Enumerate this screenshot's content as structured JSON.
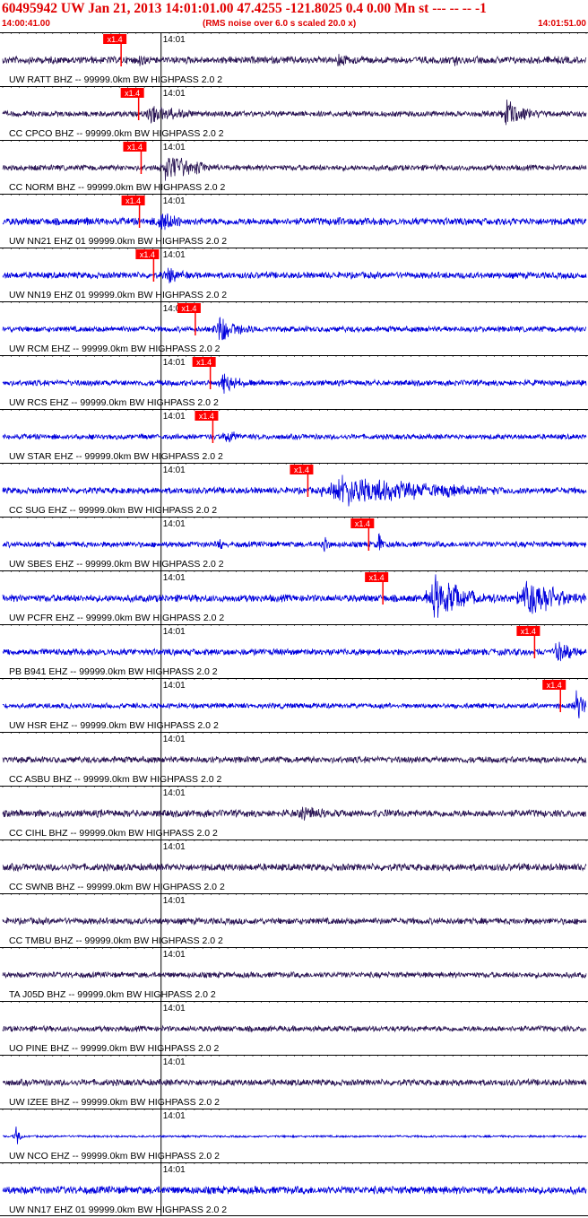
{
  "header": {
    "title": "60495942 UW Jan 21, 2013 14:01:01.00   47.4255 -121.8025  0.4 0.00 Mn st --- -- --   -1",
    "start_time": "14:00:41.00",
    "scale_note": "(RMS noise over 6.0 s scaled 20.0 x)",
    "end_time": "14:01:51.00"
  },
  "colors": {
    "header_text": "#e00000",
    "trace_dark": "#2b1655",
    "trace_blue": "#0000dd",
    "pick_marker": "#ff0000",
    "pick_text": "#ffffff"
  },
  "chart_data": {
    "type": "seismogram",
    "x_range_seconds": [
      0,
      70
    ],
    "tick_label": "14:01",
    "tick_time_s": 19,
    "traces": [
      {
        "label": "UW RATT BHZ -- 99999.0km BW  HIGHPASS  2.0  2",
        "pick_label": "x1.4",
        "pick_time_s": 14.1,
        "color": "dark",
        "amplitude": 0.28,
        "events": [
          {
            "t": 16,
            "amp": 0.45,
            "dur": 4
          },
          {
            "t": 40,
            "amp": 0.55,
            "dur": 4
          },
          {
            "t": 54,
            "amp": 0.45,
            "dur": 3
          }
        ]
      },
      {
        "label": "CC CPCO BHZ -- 99999.0km BW  HIGHPASS  2.0  2",
        "pick_label": "x1.4",
        "pick_time_s": 16.2,
        "color": "dark",
        "amplitude": 0.22,
        "events": [
          {
            "t": 17,
            "amp": 0.65,
            "dur": 10
          },
          {
            "t": 60,
            "amp": 0.9,
            "dur": 6
          }
        ]
      },
      {
        "label": "CC NORM BHZ -- 99999.0km BW  HIGHPASS  2.0  2",
        "pick_label": "x1.4",
        "pick_time_s": 16.5,
        "color": "dark",
        "amplitude": 0.22,
        "events": [
          {
            "t": 19,
            "amp": 1.0,
            "dur": 9
          }
        ]
      },
      {
        "label": "UW NN21 EHZ 01 99999.0km BW  HIGHPASS  2.0  2",
        "pick_label": "x1.4",
        "pick_time_s": 16.3,
        "color": "blue",
        "amplitude": 0.28,
        "events": [
          {
            "t": 18.5,
            "amp": 0.9,
            "dur": 5
          },
          {
            "t": 10,
            "amp": 0.4,
            "dur": 2
          },
          {
            "t": 40,
            "amp": 0.35,
            "dur": 2
          },
          {
            "t": 60,
            "amp": 0.3,
            "dur": 2
          }
        ]
      },
      {
        "label": "UW NN19 EHZ 01 99999.0km BW  HIGHPASS  2.0  2",
        "pick_label": "x1.4",
        "pick_time_s": 18.0,
        "color": "blue",
        "amplitude": 0.25,
        "events": [
          {
            "t": 19.5,
            "amp": 0.7,
            "dur": 4
          }
        ]
      },
      {
        "label": "UW RCM EHZ -- 99999.0km BW  HIGHPASS  2.0  2",
        "pick_label": "x1.4",
        "pick_time_s": 23.0,
        "color": "blue",
        "amplitude": 0.22,
        "events": [
          {
            "t": 25.5,
            "amp": 1.0,
            "dur": 6
          }
        ]
      },
      {
        "label": "UW RCS EHZ -- 99999.0km BW  HIGHPASS  2.0  2",
        "pick_label": "x1.4",
        "pick_time_s": 24.8,
        "color": "blue",
        "amplitude": 0.22,
        "events": [
          {
            "t": 26,
            "amp": 0.8,
            "dur": 5
          }
        ]
      },
      {
        "label": "UW STAR EHZ -- 99999.0km BW  HIGHPASS  2.0  2",
        "pick_label": "x1.4",
        "pick_time_s": 25.1,
        "color": "blue",
        "amplitude": 0.2,
        "events": [
          {
            "t": 26.5,
            "amp": 0.7,
            "dur": 3
          }
        ]
      },
      {
        "label": "CC SUG EHZ -- 99999.0km BW  HIGHPASS  2.0  2",
        "pick_label": "x1.4",
        "pick_time_s": 36.5,
        "color": "blue",
        "amplitude": 0.25,
        "events": [
          {
            "t": 38.5,
            "amp": 1.05,
            "dur": 28
          }
        ]
      },
      {
        "label": "UW SBES EHZ -- 99999.0km BW  HIGHPASS  2.0  2",
        "pick_label": "x1.4",
        "pick_time_s": 43.8,
        "color": "blue",
        "amplitude": 0.22,
        "events": [
          {
            "t": 26,
            "amp": 0.6,
            "dur": 1
          },
          {
            "t": 38.5,
            "amp": 0.9,
            "dur": 1
          },
          {
            "t": 45,
            "amp": 1.1,
            "dur": 1
          }
        ]
      },
      {
        "label": "UW PCFR EHZ -- 99999.0km BW  HIGHPASS  2.0  2",
        "pick_label": "x1.4",
        "pick_time_s": 45.5,
        "color": "blue",
        "amplitude": 0.28,
        "events": [
          {
            "t": 51,
            "amp": 1.45,
            "dur": 10
          },
          {
            "t": 62,
            "amp": 1.45,
            "dur": 10
          },
          {
            "t": 55.5,
            "amp": 0.6,
            "dur": 2
          }
        ]
      },
      {
        "label": "PB B941 EHZ -- 99999.0km BW  HIGHPASS  2.0  2",
        "pick_label": "x1.4",
        "pick_time_s": 63.7,
        "color": "blue",
        "amplitude": 0.25,
        "events": [
          {
            "t": 66,
            "amp": 0.8,
            "dur": 5
          }
        ]
      },
      {
        "label": "UW HSR EHZ -- 99999.0km BW  HIGHPASS  2.0  2",
        "pick_label": "x1.4",
        "pick_time_s": 66.8,
        "color": "blue",
        "amplitude": 0.2,
        "events": [
          {
            "t": 68.5,
            "amp": 1.1,
            "dur": 3
          }
        ]
      },
      {
        "label": "CC ASBU BHZ -- 99999.0km BW  HIGHPASS  2.0  2",
        "color": "dark",
        "amplitude": 0.25,
        "events": []
      },
      {
        "label": "CC CIHL BHZ -- 99999.0km BW  HIGHPASS  2.0  2",
        "color": "dark",
        "amplitude": 0.28,
        "events": [
          {
            "t": 35,
            "amp": 0.45,
            "dur": 12
          }
        ]
      },
      {
        "label": "CC SWNB BHZ -- 99999.0km BW  HIGHPASS  2.0  2",
        "color": "dark",
        "amplitude": 0.28,
        "events": []
      },
      {
        "label": "CC TMBU BHZ -- 99999.0km BW  HIGHPASS  2.0  2",
        "color": "dark",
        "amplitude": 0.25,
        "events": []
      },
      {
        "label": "TA J05D BHZ -- 99999.0km BW  HIGHPASS  2.0  2",
        "color": "dark",
        "amplitude": 0.22,
        "events": []
      },
      {
        "label": "UO PINE BHZ -- 99999.0km BW  HIGHPASS  2.0  2",
        "color": "dark",
        "amplitude": 0.22,
        "events": []
      },
      {
        "label": "UW IZEE BHZ -- 99999.0km BW  HIGHPASS  2.0  2",
        "color": "dark",
        "amplitude": 0.25,
        "events": []
      },
      {
        "label": "UW NCO EHZ -- 99999.0km BW  HIGHPASS  2.0  2",
        "color": "blue",
        "amplitude": 0.08,
        "events": [
          {
            "t": 1.5,
            "amp": 0.8,
            "dur": 1
          }
        ]
      },
      {
        "label": "UW NN17 EHZ 01 99999.0km BW  HIGHPASS  2.0  2",
        "color": "blue",
        "amplitude": 0.3,
        "events": []
      }
    ]
  }
}
